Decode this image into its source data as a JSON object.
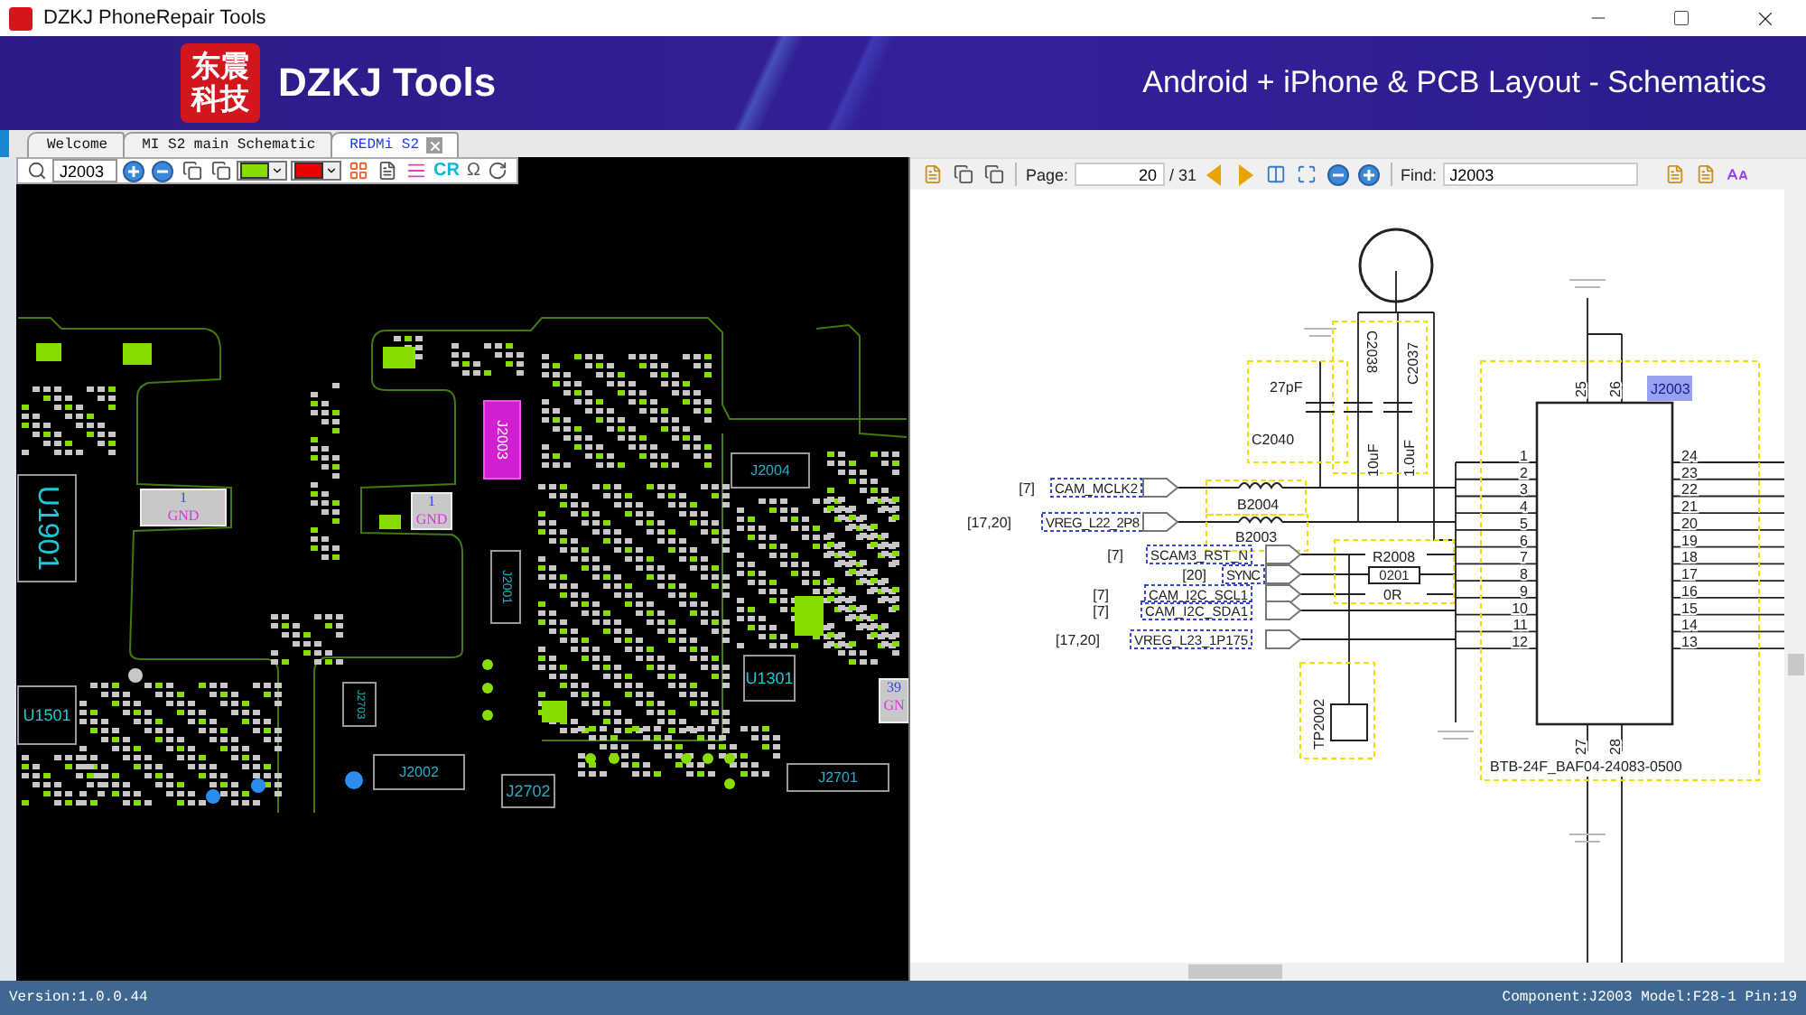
{
  "window": {
    "title": "DZKJ PhoneRepair Tools"
  },
  "banner": {
    "logo_lines": [
      "东震",
      "科技"
    ],
    "brand": "DZKJ Tools",
    "tagline": "Android + iPhone & PCB Layout - Schematics"
  },
  "tabs": [
    {
      "label": "Welcome",
      "selected": false,
      "closable": false
    },
    {
      "label": "MI S2 main Schematic",
      "selected": false,
      "closable": false
    },
    {
      "label": "REDMi S2",
      "selected": true,
      "closable": true
    }
  ],
  "pcb_toolbar": {
    "search_value": "J2003",
    "layers": [
      {
        "color": "#88dd00"
      },
      {
        "color": "#ee0000"
      }
    ],
    "cr_label": "CR",
    "omega_label": "Ω"
  },
  "pcb": {
    "parts": [
      {
        "kind": "ic",
        "ref": "U1901",
        "highlighted": false
      },
      {
        "kind": "ic",
        "ref": "U1501",
        "highlighted": false
      },
      {
        "kind": "pad",
        "pin": "1",
        "net": "GND",
        "highlighted": false
      },
      {
        "kind": "pad",
        "pin": "1",
        "net": "GND",
        "highlighted": false
      },
      {
        "kind": "connector",
        "ref": "J2003",
        "highlighted": true
      },
      {
        "kind": "connector",
        "ref": "J2004",
        "highlighted": false
      },
      {
        "kind": "connector",
        "ref": "J2001",
        "highlighted": false
      },
      {
        "kind": "connector",
        "ref": "J2703",
        "highlighted": false
      },
      {
        "kind": "connector",
        "ref": "J2002",
        "highlighted": false
      },
      {
        "kind": "connector",
        "ref": "J2702",
        "highlighted": false
      },
      {
        "kind": "connector",
        "ref": "J2701",
        "highlighted": false
      },
      {
        "kind": "ic",
        "ref": "U1301",
        "highlighted": false
      },
      {
        "kind": "pad",
        "pin": "39",
        "net": "GN",
        "highlighted": false
      }
    ]
  },
  "pdf_toolbar": {
    "page_label": "Page:",
    "page": "20",
    "page_total": "/ 31",
    "find_label": "Find:",
    "find_value": "J2003"
  },
  "schematic": {
    "connector": {
      "ref": "J2003",
      "highlighted": true,
      "part_number": "BTB-24F_BAF04-24083-0500",
      "left_pins": [
        "1",
        "2",
        "3",
        "4",
        "5",
        "6",
        "7",
        "8",
        "9",
        "10",
        "11",
        "12"
      ],
      "right_pins": [
        "24",
        "23",
        "22",
        "21",
        "20",
        "19",
        "18",
        "17",
        "16",
        "15",
        "14",
        "13"
      ],
      "top_pins": [
        "25",
        "26"
      ],
      "bottom_pins": [
        "27",
        "28"
      ]
    },
    "nets": [
      {
        "ref": "[7]",
        "name": "CAM_MCLK2"
      },
      {
        "ref": "[17,20]",
        "name": "VREG_L22_2P8"
      },
      {
        "ref": "[7]",
        "name": "SCAM3_RST_N"
      },
      {
        "ref": "[20]",
        "name": "SYNC"
      },
      {
        "ref": "[7]",
        "name": "CAM_I2C_SCL1"
      },
      {
        "ref": "[7]",
        "name": "CAM_I2C_SDA1"
      },
      {
        "ref": "[17,20]",
        "name": "VREG_L23_1P175"
      }
    ],
    "components": [
      {
        "kind": "capacitor",
        "ref": "C2040",
        "value": "27pF"
      },
      {
        "kind": "capacitor",
        "ref": "C2038",
        "value": "10uF"
      },
      {
        "kind": "capacitor",
        "ref": "C2037",
        "value": "1.0uF"
      },
      {
        "kind": "bead",
        "ref": "B2004"
      },
      {
        "kind": "bead",
        "ref": "B2003"
      },
      {
        "kind": "resistor",
        "ref": "R2008",
        "size": "0201",
        "value": "0R"
      },
      {
        "kind": "test_point",
        "ref": "TP2002"
      }
    ]
  },
  "status_bar": {
    "version": "Version:1.0.0.44",
    "info": "Component:J2003 Model:F28-1 Pin:19"
  }
}
